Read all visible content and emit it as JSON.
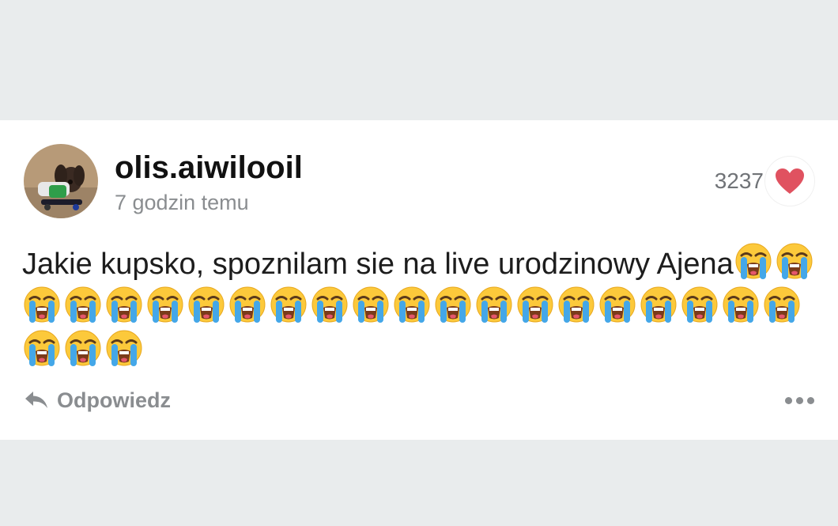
{
  "post": {
    "username": "olis.aiwilooil",
    "timestamp": "7 godzin temu",
    "likes": "3237",
    "text": "Jakie kupsko, spoznilam sie na live urodzinowy Ajena",
    "emoji": "loudly-crying-face",
    "emoji_count": 24
  },
  "actions": {
    "reply_label": "Odpowiedz",
    "more_icon": "more-dots-icon"
  },
  "colors": {
    "background": "#e9eced",
    "card": "#ffffff",
    "heart": "#e05260",
    "muted_text": "#8a8d90"
  }
}
